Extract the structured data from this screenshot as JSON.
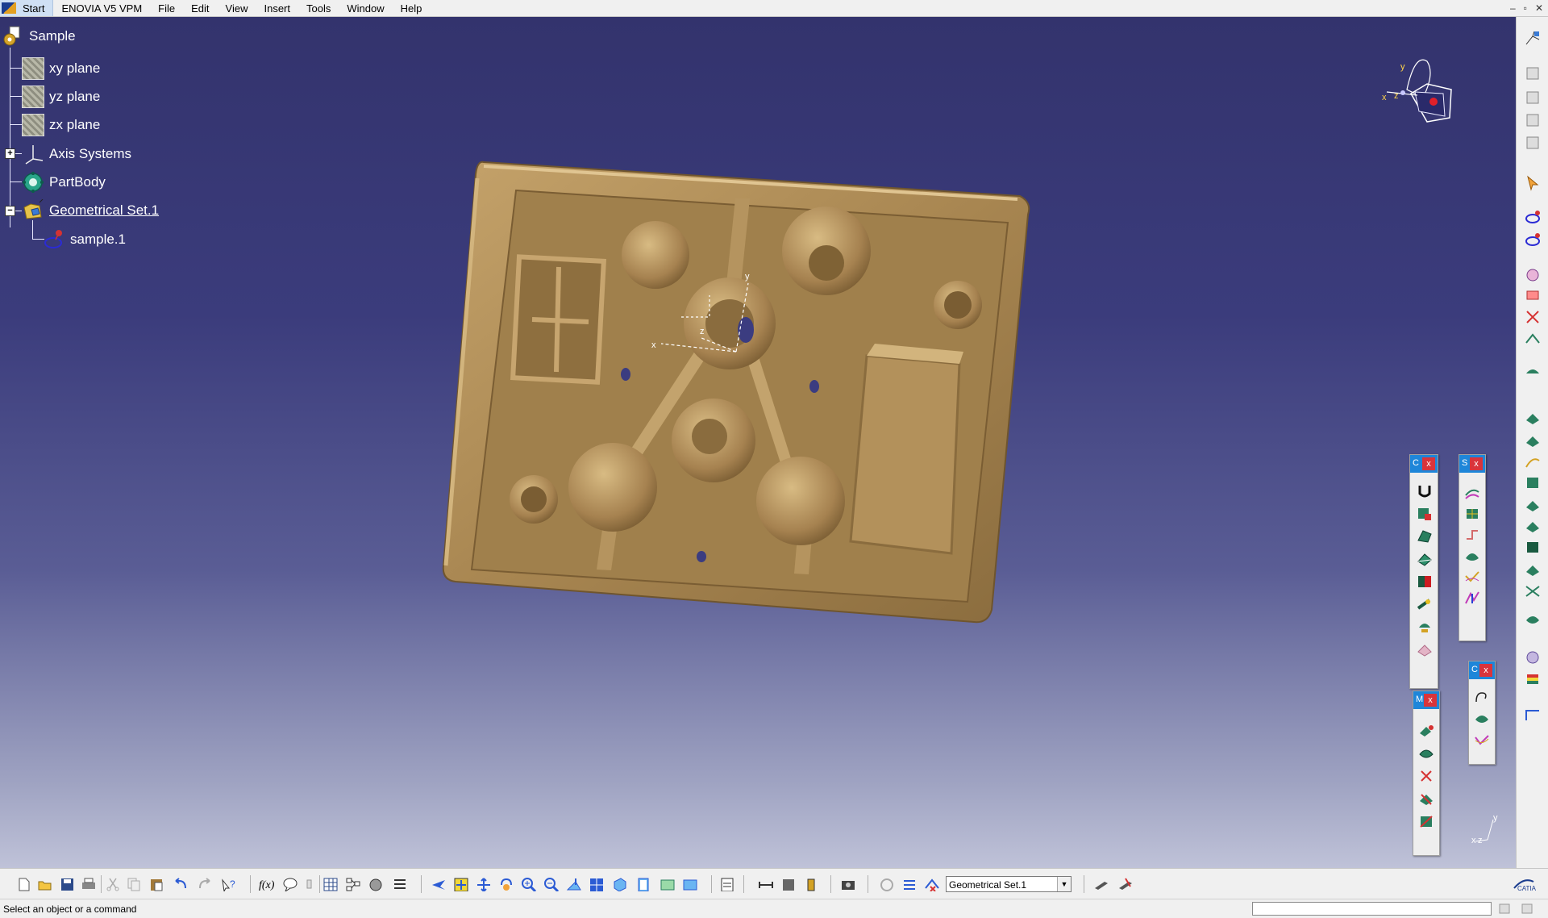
{
  "menubar": {
    "start": "Start",
    "app": "ENOVIA V5 VPM",
    "items": [
      "File",
      "Edit",
      "View",
      "Insert",
      "Tools",
      "Window",
      "Help"
    ]
  },
  "window_controls": [
    "–",
    "▫",
    "✕"
  ],
  "tree": {
    "root": "Sample",
    "items": [
      {
        "label": "xy plane",
        "icon": "plane-icon"
      },
      {
        "label": "yz plane",
        "icon": "plane-icon"
      },
      {
        "label": "zx plane",
        "icon": "plane-icon"
      },
      {
        "label": "Axis Systems",
        "icon": "axis-system-icon"
      },
      {
        "label": "PartBody",
        "icon": "part-body-icon"
      },
      {
        "label": "Geometrical Set.1",
        "icon": "geometrical-set-icon"
      },
      {
        "label": "sample.1",
        "icon": "cloud-icon"
      }
    ]
  },
  "compass": {
    "x": "x",
    "y": "y",
    "z": "z"
  },
  "axis_labels": {
    "x": "x",
    "y": "y",
    "z": "z"
  },
  "floating_toolbars": [
    {
      "title": "C",
      "icons": 8
    },
    {
      "title": "S",
      "icons": 6
    },
    {
      "title": "M",
      "icons": 5
    },
    {
      "title": "C",
      "icons": 3
    }
  ],
  "bottom_toolbar": {
    "current_layer": "Geometrical Set.1"
  },
  "status": {
    "message": "Select an object or a command"
  },
  "colors": {
    "part": "#b08e5a",
    "background_top": "#33336d",
    "background_bottom": "#bfc2d8"
  }
}
